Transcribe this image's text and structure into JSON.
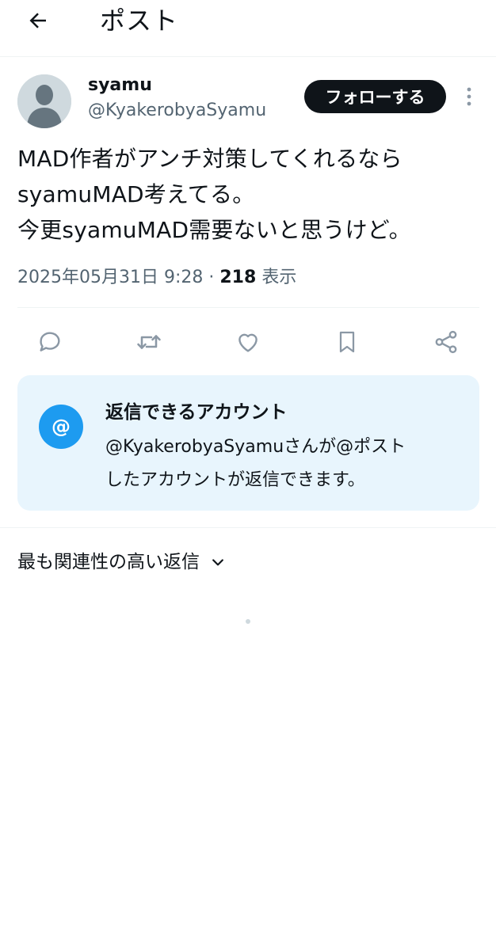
{
  "header": {
    "title": "ポスト",
    "back_icon": "arrow-left-icon"
  },
  "author": {
    "display_name": "syamu",
    "handle": "@KyakerobyaSyamu",
    "avatar_icon": "default-avatar-icon",
    "follow_label": "フォローする",
    "more_icon": "more-vertical-icon"
  },
  "post": {
    "lines": [
      "MAD作者がアンチ対策してくれるなら",
      "syamuMAD考えてる。",
      "今更syamuMAD需要ないと思うけど。"
    ],
    "timestamp": "2025年05月31日 9:28",
    "separator": "·",
    "views_count": "218",
    "views_label": "表示"
  },
  "actions": [
    {
      "name": "reply-icon"
    },
    {
      "name": "repost-icon"
    },
    {
      "name": "like-icon"
    },
    {
      "name": "bookmark-icon"
    },
    {
      "name": "share-icon"
    }
  ],
  "reply_restriction": {
    "badge": "@",
    "title": "返信できるアカウント",
    "description_lines": [
      "@KyakerobyaSyamuさんが@ポスト",
      "したアカウントが返信できます。"
    ]
  },
  "replies_sort": {
    "label": "最も関連性の高い返信",
    "icon": "chevron-down-icon"
  },
  "colors": {
    "text_primary": "#0f1419",
    "text_secondary": "#536471",
    "accent": "#1d9bf0",
    "card_background": "#e8f5fd",
    "divider": "#eff3f4"
  }
}
